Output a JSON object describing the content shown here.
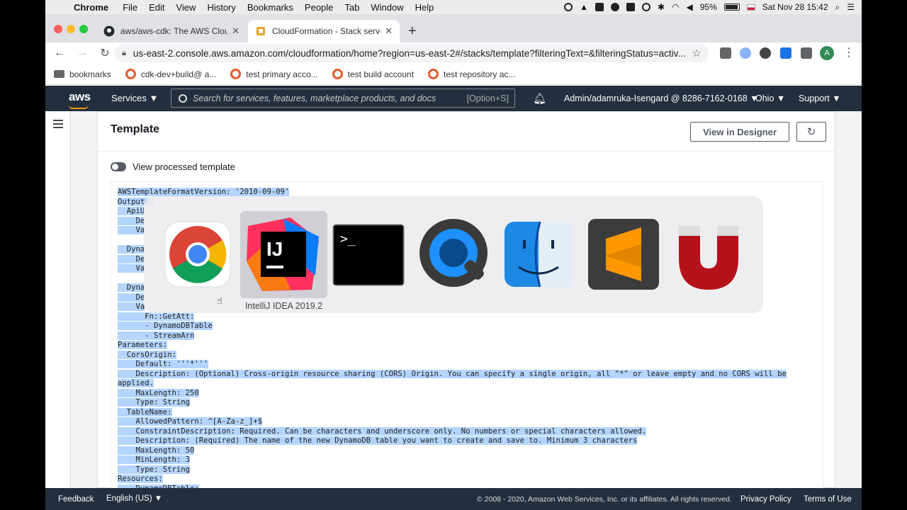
{
  "menubar": {
    "app": "Chrome",
    "items": [
      "File",
      "Edit",
      "View",
      "History",
      "Bookmarks",
      "People",
      "Tab",
      "Window",
      "Help"
    ],
    "battery": "95%",
    "datetime": "Sat Nov 28  15:42"
  },
  "tabs": [
    {
      "title": "aws/aws-cdk: The AWS Cloud",
      "active": false
    },
    {
      "title": "CloudFormation - Stack server",
      "active": true
    }
  ],
  "address": {
    "url": "us-east-2.console.aws.amazon.com/cloudformation/home?region=us-east-2#/stacks/template?filteringText=&filteringStatus=activ...",
    "avatar_letter": "A"
  },
  "bookmarks": [
    {
      "label": "bookmarks",
      "icon": "folder-icon"
    },
    {
      "label": "cdk-dev+build@ a...",
      "icon": "bookmark-favicon-icon"
    },
    {
      "label": "test primary acco...",
      "icon": "bookmark-favicon-icon"
    },
    {
      "label": "test build account",
      "icon": "bookmark-favicon-icon"
    },
    {
      "label": "test repository ac...",
      "icon": "bookmark-favicon-icon"
    }
  ],
  "awsnav": {
    "services": "Services",
    "search_placeholder": "Search for services, features, marketplace products, and docs",
    "search_shortcut": "[Option+S]",
    "account": "Admin/adamruka-Isengard @ 8286-7162-0168",
    "region": "Ohio",
    "support": "Support"
  },
  "panel": {
    "title": "Template",
    "designer_button": "View in Designer",
    "toggle_label": "View processed template"
  },
  "template_lines": [
    "AWSTemplateFormatVersion: '2010-09-09'",
    "Outputs:",
    "  ApiU",
    "    De",
    "    Va",
    "",
    "  Dyna",
    "    De",
    "    Va",
    "",
    "  Dyna",
    "    De",
    "    Va",
    "      Fn::GetAtt:",
    "      - DynamoDBTable",
    "      - StreamArn",
    "Parameters:",
    "  CorsOrigin:",
    "    Default: '''*'''",
    "    Description: (Optional) Cross-origin resource sharing (CORS) Origin. You can specify a single origin, all \"*\" or leave empty and no CORS will be",
    "applied.",
    "    MaxLength: 250",
    "    Type: String",
    "  TableName:",
    "    AllowedPattern: ^[A-Za-z_]+$",
    "    ConstraintDescription: Required. Can be characters and underscore only. No numbers or special characters allowed.",
    "    Description: (Required) The name of the new DynamoDB table you want to create and save to. Minimum 3 characters",
    "    MaxLength: 50",
    "    MinLength: 3",
    "    Type: String",
    "Resources:",
    "    DynamoDBTable:"
  ],
  "switcher": {
    "apps": [
      {
        "name": "Chrome",
        "icon": "chrome-icon"
      },
      {
        "name": "IntelliJ IDEA 2019.2",
        "icon": "intellij-icon"
      },
      {
        "name": "Terminal",
        "icon": "terminal-icon"
      },
      {
        "name": "QuickTime Player",
        "icon": "quicktime-icon"
      },
      {
        "name": "Finder",
        "icon": "finder-icon"
      },
      {
        "name": "Sublime Text",
        "icon": "sublime-icon"
      },
      {
        "name": "Magnet",
        "icon": "magnet-icon"
      }
    ],
    "selected_label": "IntelliJ IDEA 2019.2"
  },
  "footer": {
    "feedback": "Feedback",
    "language": "English (US)",
    "copyright": "© 2008 - 2020, Amazon Web Services, Inc. or its affiliates. All rights reserved.",
    "privacy": "Privacy Policy",
    "terms": "Terms of Use"
  },
  "colors": {
    "aws_nav": "#232f3e",
    "aws_orange": "#ff9900",
    "selection": "#b4d5fe"
  }
}
